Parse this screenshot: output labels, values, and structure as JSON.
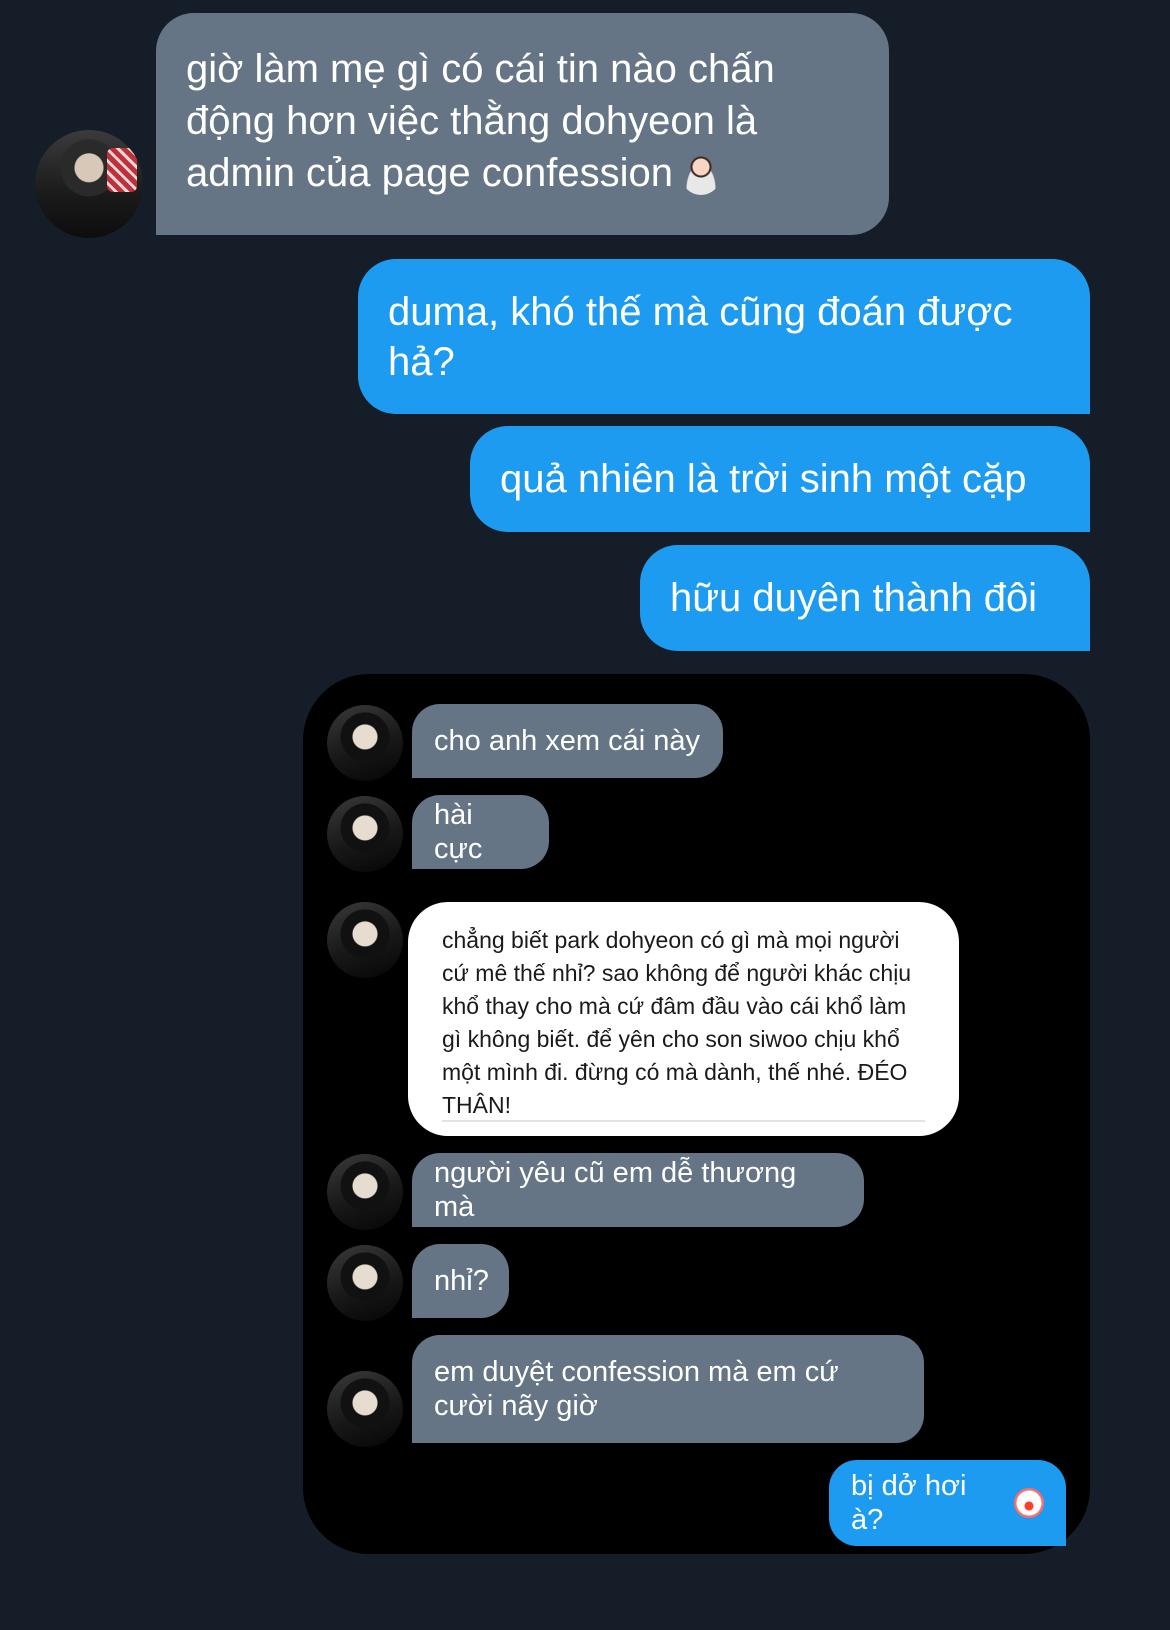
{
  "conversation": {
    "incoming_avatar": {
      "icon": "user-avatar"
    },
    "incoming_message": "giờ làm mẹ gì có cái tin nào chấn động hơn việc thằng dohyeon là admin của page confession",
    "incoming_emoji": "person-shrugging-emoji",
    "outgoing_messages": [
      "duma, khó thế mà cũng đoán được hả?",
      "quả nhiên là trời sinh một cặp",
      "hữu duyên thành đôi"
    ]
  },
  "screenshot": {
    "contact_avatar": {
      "icon": "contact-avatar"
    },
    "messages": [
      "cho anh xem cái này",
      "hài cực"
    ],
    "confession_card": {
      "text": "chẳng biết park dohyeon có gì mà mọi người cứ mê thế nhỉ? sao không để người khác chịu khổ thay cho mà cứ đâm đầu vào cái khổ làm gì không biết. để yên cho son siwoo chịu khổ một mình đi. đừng có mà dành, thế nhé. ĐÉO THÂN!"
    },
    "messages_after": [
      "người yêu cũ em dễ thương mà",
      "nhỉ?",
      "em duyệt confession mà em cứ cười nãy giờ"
    ],
    "outgoing_message": "bị dở hơi à?",
    "outgoing_emoji": "clown-face-emoji"
  },
  "colors": {
    "background": "#151e28",
    "incoming_bubble": "#657585",
    "outgoing_bubble": "#1d9bf0",
    "screenshot_background": "#000000"
  }
}
